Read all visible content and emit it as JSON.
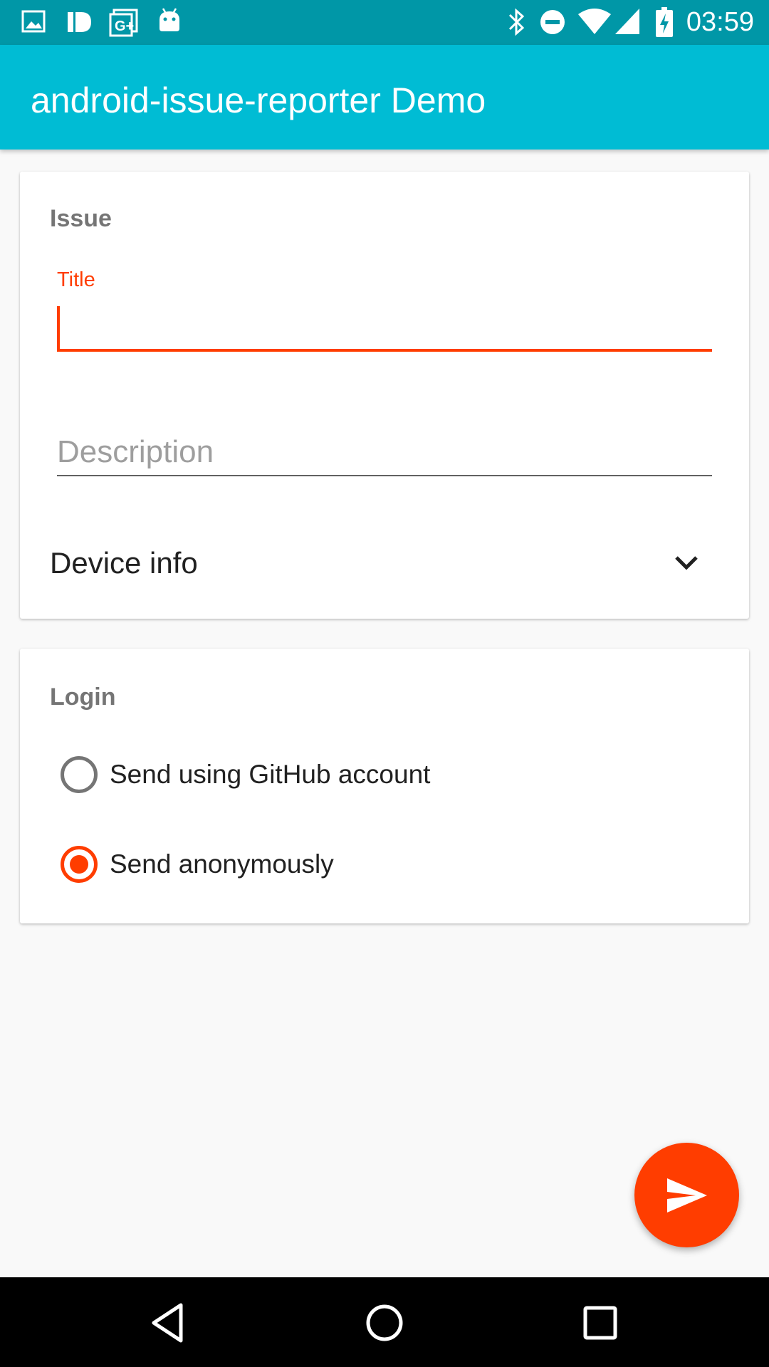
{
  "status_bar": {
    "time": "03:59",
    "left_icons": [
      "image-icon",
      "id-icon",
      "google-plus-icon",
      "android-icon"
    ],
    "right_icons": [
      "bluetooth-icon",
      "do-not-disturb-icon",
      "wifi-icon",
      "cell-signal-icon",
      "battery-charging-icon"
    ]
  },
  "app_bar": {
    "title": "android-issue-reporter Demo"
  },
  "issue_card": {
    "section_label": "Issue",
    "title_field": {
      "label": "Title",
      "value": ""
    },
    "description_field": {
      "placeholder": "Description",
      "value": ""
    },
    "device_info": {
      "label": "Device info",
      "icon": "chevron-down-icon"
    }
  },
  "login_card": {
    "section_label": "Login",
    "options": [
      {
        "label": "Send using GitHub account",
        "selected": false
      },
      {
        "label": "Send anonymously",
        "selected": true
      }
    ]
  },
  "fab": {
    "icon": "send-icon"
  },
  "nav_bar": {
    "buttons": [
      "back-icon",
      "home-icon",
      "recents-icon"
    ]
  },
  "colors": {
    "status_bar": "#0097a7",
    "app_bar": "#00bcd4",
    "accent": "#ff3d00",
    "background": "#f9f9f9"
  }
}
